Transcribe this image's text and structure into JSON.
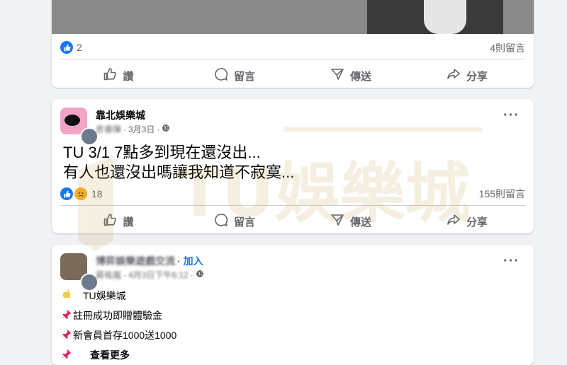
{
  "post1": {
    "reactions_count": "2",
    "comments": "4則留言"
  },
  "actions": {
    "like": "讚",
    "comment": "留言",
    "share_send": "傳送",
    "share": "分享"
  },
  "post2": {
    "page_name": "靠北娛樂城",
    "author": "彦睿陳",
    "date": "3月3日",
    "line1": "TU 3/1 7點多到現在還沒出...",
    "line2": "有人也還沒出嗎讓我知道不寂寞...",
    "reactions_count": "18",
    "comments": "155則留言",
    "watermark": "TU娛樂城"
  },
  "post3": {
    "group_name": "博弈娛樂遊戲交流",
    "join": "加入",
    "author": "蔣祐嵐",
    "date": "4月3日下午6:12",
    "line1": "TU娛樂城",
    "line2": "註冊成功即贈體驗金",
    "line3": "新會員首存1000送1000",
    "line4": "查看更多"
  },
  "icons": [
    "like-icon",
    "comment-icon",
    "send-icon",
    "share-icon",
    "globe-icon",
    "more-icon",
    "pin-icon",
    "hand-icon"
  ],
  "colors": {
    "accent": "#1877f2",
    "muted": "#65676b",
    "background": "#f0f2f5"
  }
}
